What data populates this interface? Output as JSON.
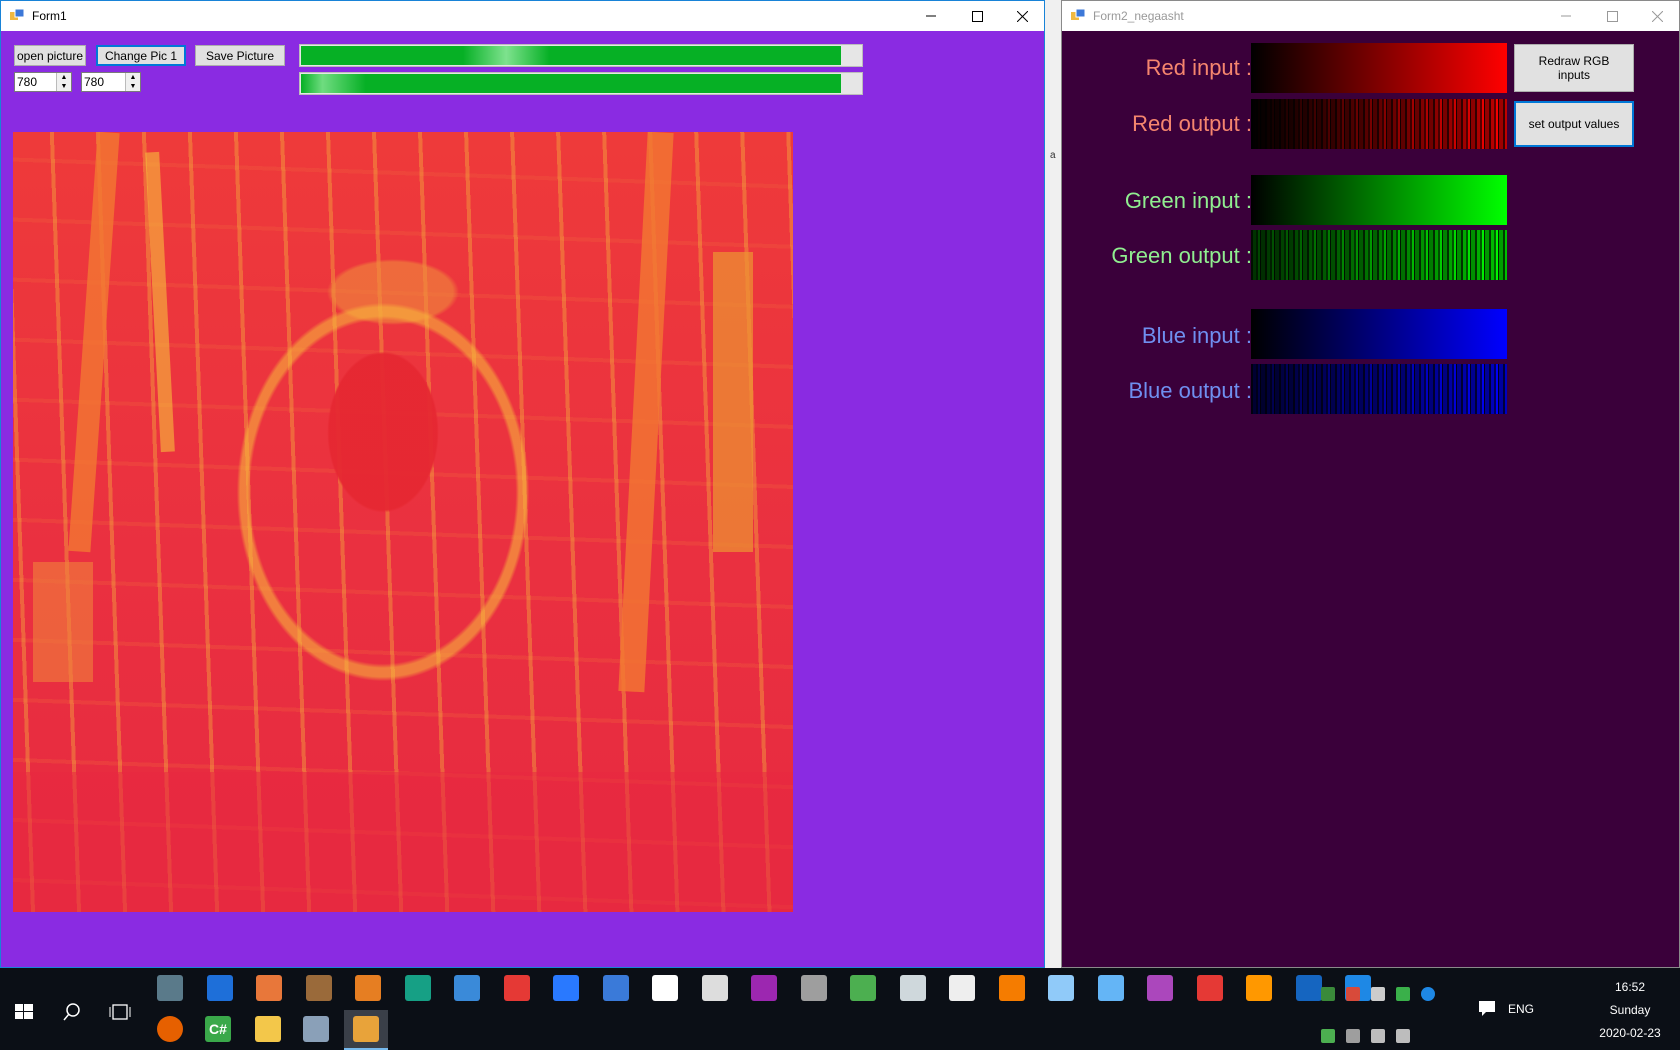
{
  "form1": {
    "title": "Form1",
    "buttons": {
      "open": "open picture",
      "change": "Change Pic 1",
      "save": "Save Picture"
    },
    "width_value": "780",
    "height_value": "780",
    "progress1": 1.0,
    "progress2": 1.0
  },
  "form2": {
    "title": "Form2_negaasht",
    "labels": {
      "red_in": "Red input :",
      "red_out": "Red output :",
      "green_in": "Green input :",
      "green_out": "Green output :",
      "blue_in": "Blue input :",
      "blue_out": "Blue output :"
    },
    "buttons": {
      "redraw": "Redraw RGB inputs",
      "set_output": "set output values"
    }
  },
  "desk_strip_char": "a",
  "taskbar": {
    "time": "16:52",
    "day": "Sunday",
    "date": "2020-02-23",
    "language": "ENG",
    "icons": [
      "app-icon",
      "app-icon",
      "app-icon",
      "app-icon",
      "app-icon",
      "e-browser-icon",
      "app-icon",
      "app-icon",
      "app-icon",
      "app-icon",
      "document-icon",
      "calculator-icon",
      "app-icon",
      "app-icon",
      "app-icon",
      "app-icon",
      "app-icon",
      "piano-icon",
      "app-icon",
      "app-icon",
      "app-icon",
      "app-icon",
      "app-icon",
      "vlc-icon",
      "app-icon",
      "edge-icon"
    ]
  }
}
